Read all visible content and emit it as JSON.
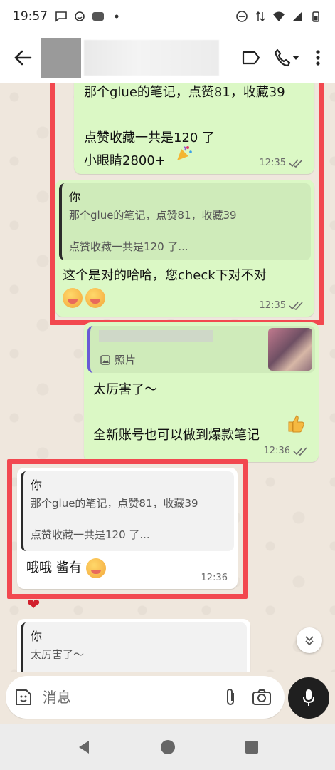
{
  "status_bar": {
    "time": "19:57"
  },
  "header": {
    "contact_name": ""
  },
  "messages": [
    {
      "direction": "out",
      "text": "那个glue的笔记，点赞81，收藏39\n\n点赞收藏一共是120 了\n小眼睛2800+",
      "time": "12:35"
    },
    {
      "direction": "out",
      "quote": {
        "author": "你",
        "line1": "那个glue的笔记，点赞81，收藏39",
        "line2": "点赞收藏一共是120 了..."
      },
      "text": "这个是对的哈哈，您check下对不对",
      "time": "12:35"
    },
    {
      "direction": "out",
      "quote": {
        "label": "照片"
      },
      "text": "太厉害了～\n\n全新账号也可以做到爆款笔记",
      "time": "12:36"
    },
    {
      "direction": "in",
      "quote": {
        "author": "你",
        "line1": "那个glue的笔记，点赞81，收藏39",
        "line2": "点赞收藏一共是120 了..."
      },
      "text": "哦哦 酱有",
      "time": "12:36"
    },
    {
      "direction": "in",
      "quote": {
        "author": "你",
        "line1": "太厉害了～"
      }
    }
  ],
  "composer": {
    "placeholder": "消息"
  },
  "colors": {
    "outgoing": "#dbf8c5",
    "incoming": "#ffffff",
    "highlight": "#f2484f",
    "background": "#efe7dd"
  },
  "icons": [
    "back-arrow-icon",
    "label-icon",
    "phone-icon",
    "chevron-down-icon",
    "more-vert-icon",
    "sticker-icon",
    "attach-icon",
    "camera-icon",
    "mic-icon",
    "scroll-down-icon"
  ]
}
